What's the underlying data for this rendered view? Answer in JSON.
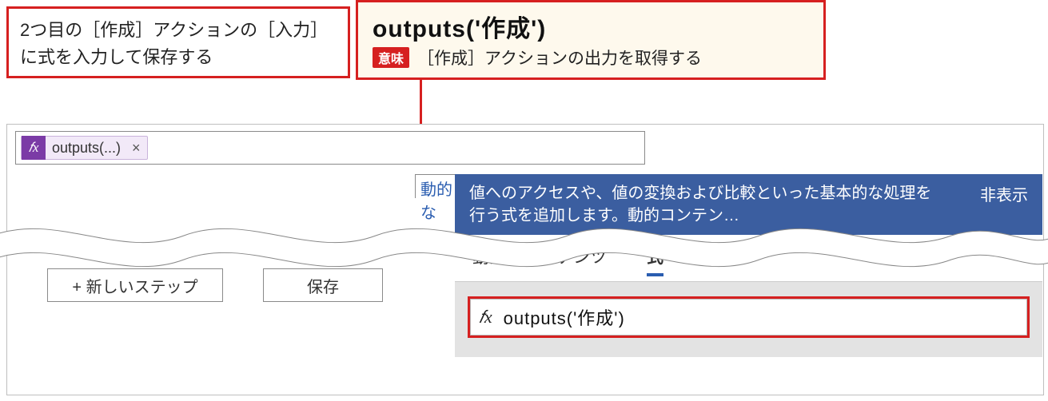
{
  "callouts": {
    "left_text": "2つ目の［作成］アクションの［入力］に式を入力して保存する",
    "right_title": "outputs('作成')",
    "imi_label": "意味",
    "right_desc": "［作成］アクションの出力を取得する"
  },
  "chip": {
    "label": "outputs(...)",
    "close": "×"
  },
  "buttons": {
    "new_step": "+ 新しいステップ",
    "save": "保存"
  },
  "panel": {
    "peek_label": "動的な",
    "header_text": "値へのアクセスや、値の変換および比較といった基本的な処理を行う式を追加します。動的コンテン…",
    "hide_label": "非表示",
    "tab_dynamic": "動的なコンテンツ",
    "tab_expression": "式",
    "fx_label": "𝑓x",
    "expression_value": "outputs('作成')"
  }
}
